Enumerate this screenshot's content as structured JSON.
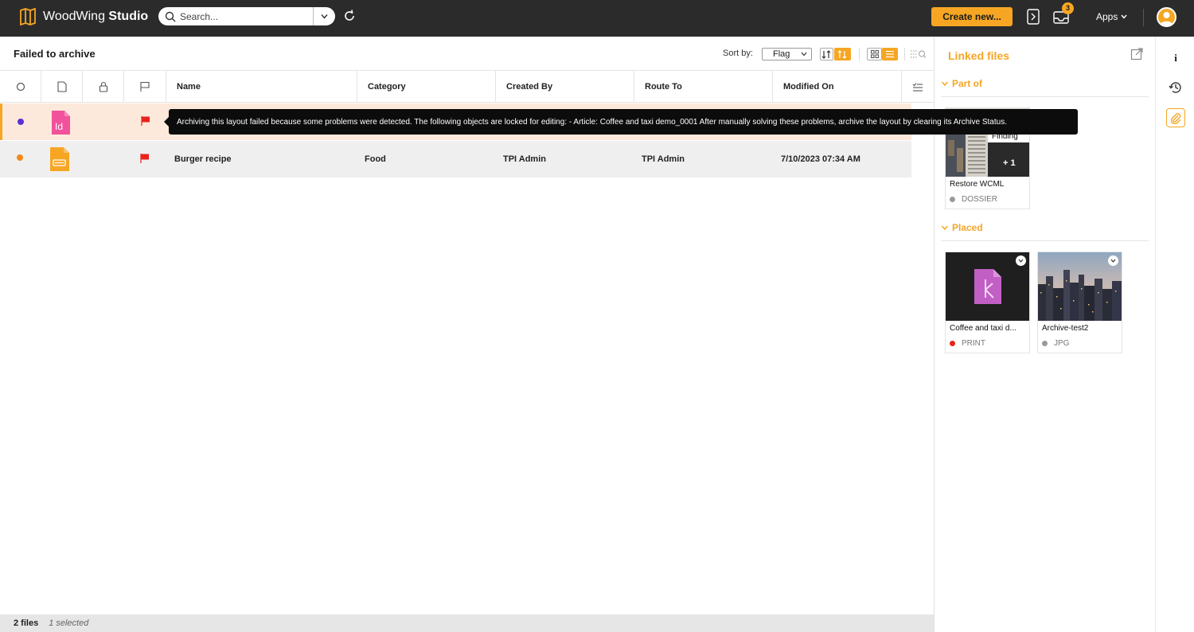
{
  "app": {
    "brand_light": "WoodWing",
    "brand_bold": "Studio",
    "search_placeholder": "Search...",
    "create_label": "Create new...",
    "notification_count": "3",
    "apps_label": "Apps",
    "accent_color": "#f6a623"
  },
  "toolbar": {
    "title": "Failed to archive",
    "sort_label": "Sort by:",
    "sort_value": "Flag"
  },
  "table": {
    "columns": [
      "Name",
      "Category",
      "Created By",
      "Route To",
      "Modified On"
    ],
    "rows": [
      {
        "status_color": "#5b2fd6",
        "file_type": "indesign-icon",
        "name": "",
        "category": "",
        "created_by": "",
        "route_to": "",
        "modified_on": "",
        "flagged": true,
        "selected": true
      },
      {
        "status_color": "#f28a17",
        "file_type": "article-icon",
        "name": "Burger recipe",
        "category": "Food",
        "created_by": "TPI Admin",
        "route_to": "TPI Admin",
        "modified_on": "7/10/2023 07:34 AM",
        "flagged": true,
        "selected": false
      }
    ]
  },
  "tooltip": {
    "text": "Archiving this layout failed because some problems were detected. The following objects are locked for editing: - Article: Coffee and taxi demo_0001 After manually solving these problems, archive the layout by clearing its Archive Status."
  },
  "status_bar": {
    "count": "2 files",
    "selected": "1 selected"
  },
  "linked_files": {
    "title": "Linked files",
    "part_of": {
      "heading": "Part of",
      "cards": [
        {
          "title": "Restore WCML",
          "type": "DOSSIER",
          "dot": "#9a9a9a",
          "overlay_label": "Finding",
          "overlay_count": "+ 1"
        }
      ]
    },
    "placed": {
      "heading": "Placed",
      "cards": [
        {
          "title": "Coffee and taxi d...",
          "type": "PRINT",
          "dot": "#e8231b"
        },
        {
          "title": "Archive-test2",
          "type": "JPG",
          "dot": "#9a9a9a"
        }
      ]
    }
  },
  "rail": {
    "info_label": "i"
  }
}
